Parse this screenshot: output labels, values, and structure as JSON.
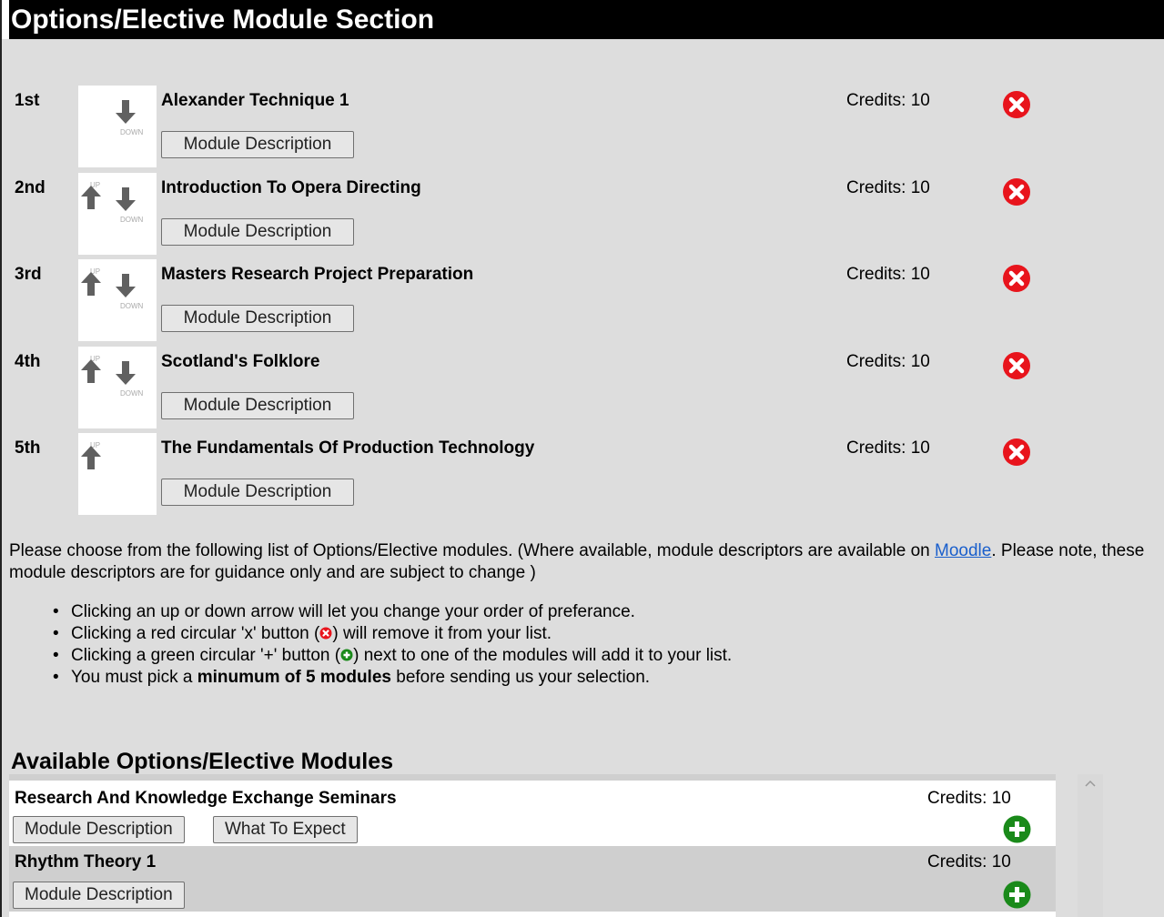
{
  "header": {
    "title": "Options/Elective Module Section"
  },
  "selected_modules": [
    {
      "rank": "1st",
      "name": "Alexander Technique 1",
      "credits": "Credits: 10",
      "button": "Module Description",
      "arrows": "down"
    },
    {
      "rank": "2nd",
      "name": "Introduction To Opera Directing",
      "credits": "Credits: 10",
      "button": "Module Description",
      "arrows": "both"
    },
    {
      "rank": "3rd",
      "name": "Masters Research Project Preparation",
      "credits": "Credits: 10",
      "button": "Module Description",
      "arrows": "both"
    },
    {
      "rank": "4th",
      "name": "Scotland's Folklore",
      "credits": "Credits: 10",
      "button": "Module Description",
      "arrows": "both"
    },
    {
      "rank": "5th",
      "name": "The Fundamentals Of Production Technology",
      "credits": "Credits: 10",
      "button": "Module Description",
      "arrows": "up"
    }
  ],
  "arrow_labels": {
    "up": "UP",
    "down": "DOWN"
  },
  "instructions": {
    "intro_before_link": "Please choose from the following list of Options/Elective modules. (Where available, module descriptors are available on ",
    "link_text": "Moodle",
    "intro_after_link": ". Please note, these module descriptors are for guidance only and are subject to change )",
    "bullet1": "Clicking an up or down arrow will let you change your order of preferance.",
    "bullet2_before": "Clicking a red circular 'x' button (",
    "bullet2_after": ") will remove it from your list.",
    "bullet3_before": "Clicking a green circular '+' button (",
    "bullet3_after": ") next to one of the modules will add it to your list.",
    "bullet4_before": "You must pick a ",
    "bullet4_bold": "minumum of 5 modules",
    "bullet4_after": " before sending us your selection."
  },
  "available": {
    "title": "Available Options/Elective Modules",
    "items": [
      {
        "name": "Research And Knowledge Exchange Seminars",
        "credits": "Credits: 10",
        "button1": "Module Description",
        "button2": "What To Expect"
      },
      {
        "name": "Rhythm Theory 1",
        "credits": "Credits: 10",
        "button1": "Module Description"
      }
    ]
  },
  "colors": {
    "remove": "#e8141c",
    "add": "#1a8a1a",
    "header_bg": "#000000",
    "page_bg": "#dddddd",
    "row_alt": "#cfcfcf",
    "link": "#1a5fcc"
  },
  "icons": {
    "remove": "red-circle-x-icon",
    "add": "green-circle-plus-icon",
    "up": "up-arrow-icon",
    "down": "down-arrow-icon"
  }
}
